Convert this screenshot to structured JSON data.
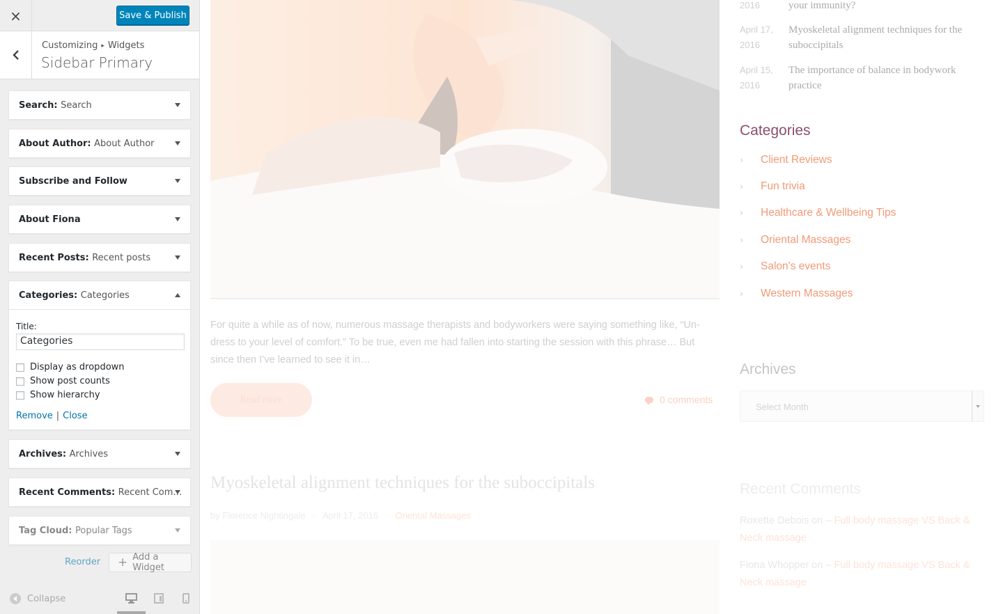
{
  "customizer": {
    "close_icon": "×",
    "save_label": "Save & Publish",
    "breadcrumb": {
      "root": "Customizing",
      "separator": "▸",
      "section": "Widgets"
    },
    "section_title": "Sidebar Primary",
    "widgets": [
      {
        "name": "Search",
        "subtitle": "Search"
      },
      {
        "name": "About Author",
        "subtitle": "About Author"
      },
      {
        "name": "Subscribe and Follow",
        "subtitle": ""
      },
      {
        "name": "About Fiona",
        "subtitle": ""
      },
      {
        "name": "Recent Posts",
        "subtitle": "Recent posts"
      },
      {
        "name": "Categories",
        "subtitle": "Categories"
      },
      {
        "name": "Archives",
        "subtitle": "Archives"
      },
      {
        "name": "Recent Comments",
        "subtitle": "Recent Com…"
      },
      {
        "name": "Tag Cloud",
        "subtitle": "Popular Tags"
      }
    ],
    "categories_form": {
      "title_label": "Title:",
      "title_value": "Categories",
      "options": [
        {
          "label": "Display as dropdown",
          "checked": false
        },
        {
          "label": "Show post counts",
          "checked": false
        },
        {
          "label": "Show hierarchy",
          "checked": false
        }
      ],
      "remove_label": "Remove",
      "divider": "|",
      "close_label": "Close"
    },
    "reorder_label": "Reorder",
    "add_widget_label": "Add a Widget",
    "collapse_label": "Collapse",
    "device_icons": [
      "desktop-icon",
      "tablet-icon",
      "mobile-icon"
    ],
    "accent_color": "#0085ba"
  },
  "preview": {
    "excerpt": "For quite a while as of now, numerous massage therapists and bodyworkers were saying something like, “Un-dress to your level of comfort.” To be true, even me had fallen into starting the session with this phrase… But since then I’ve learned to see it in…",
    "read_more": "Read more",
    "comments_count": "0 comments",
    "post2": {
      "title": "Myoskeletal alignment techniques for the suboccipitals",
      "author": "by Florence Nightingale",
      "sep": "·",
      "date": "April 17, 2016",
      "category": "Oriental Massages"
    },
    "recent_posts": [
      {
        "date": "2016",
        "title": "your immunity?"
      },
      {
        "date": "April 17, 2016",
        "title": "Myoskeletal alignment techniques for the suboccipitals"
      },
      {
        "date": "April 15, 2016",
        "title": "The importance of balance in bodywork practice"
      }
    ],
    "categories": {
      "heading": "Categories",
      "items": [
        "Client Reviews",
        "Fun trivia",
        "Healthcare & Wellbeing Tips",
        "Oriental Massages",
        "Salon's events",
        "Western Massages"
      ],
      "link_color": "#f29a76"
    },
    "archives": {
      "heading": "Archives",
      "select_value": "Select Month"
    },
    "recent_comments": {
      "heading": "Recent Comments",
      "items": [
        {
          "author": "Roxette Debois",
          "on": "on –",
          "post": "Full body massage VS Back & Neck massage"
        },
        {
          "author": "Fiona Whopper",
          "on": "on –",
          "post": "Full body massage VS Back & Neck massage"
        }
      ]
    }
  }
}
